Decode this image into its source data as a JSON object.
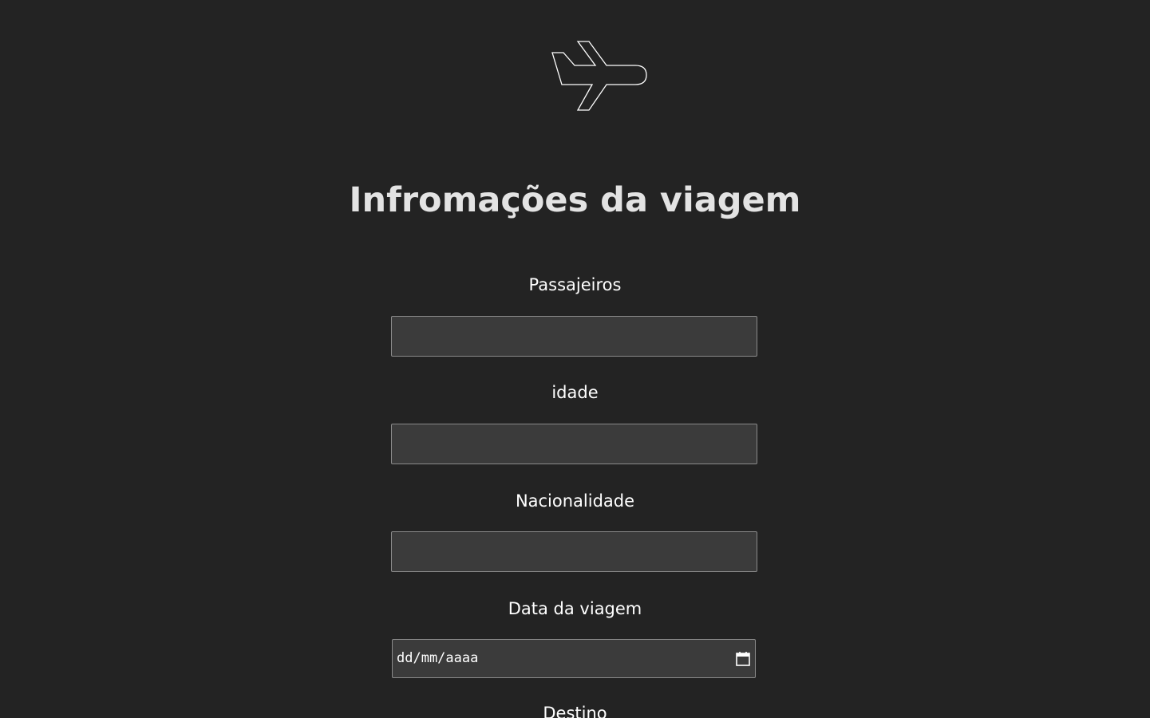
{
  "header": {
    "logo_icon": "airplane-icon",
    "title": "Infromações da viagem"
  },
  "form": {
    "passengers": {
      "label": "Passajeiros",
      "value": ""
    },
    "age": {
      "label": "idade",
      "value": ""
    },
    "nationality": {
      "label": "Nacionalidade",
      "value": ""
    },
    "travel_date": {
      "label": "Data da viagem",
      "placeholder": "dd/mm/aaaa",
      "icon": "calendar-icon"
    },
    "destination": {
      "label": "Destino"
    }
  },
  "colors": {
    "background": "#232323",
    "input_background": "#3b3b3b",
    "input_border": "#8a8a8a",
    "title": "#e3e3e3",
    "text": "#ffffff"
  }
}
